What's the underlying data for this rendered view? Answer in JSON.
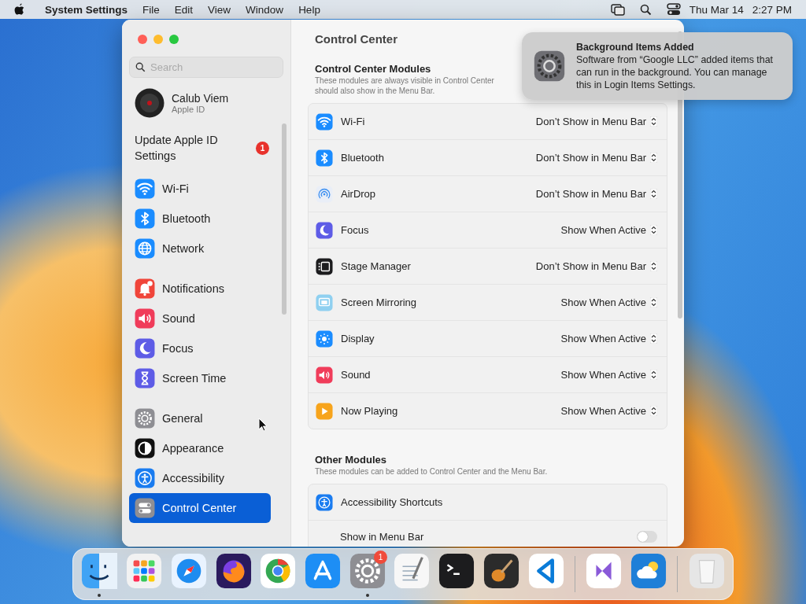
{
  "menu_bar": {
    "app_name": "System Settings",
    "menus": [
      "File",
      "Edit",
      "View",
      "Window",
      "Help"
    ],
    "date": "Thu Mar 14",
    "time": "2:27 PM"
  },
  "sidebar": {
    "search": {
      "placeholder": "Search"
    },
    "account": {
      "name": "Calub Viem",
      "subtitle": "Apple ID"
    },
    "update": {
      "label": "Update Apple ID Settings",
      "badge": "1"
    },
    "groups": [
      [
        {
          "label": "Wi-Fi",
          "selected": false
        },
        {
          "label": "Bluetooth",
          "selected": false
        },
        {
          "label": "Network",
          "selected": false
        }
      ],
      [
        {
          "label": "Notifications",
          "selected": false
        },
        {
          "label": "Sound",
          "selected": false
        },
        {
          "label": "Focus",
          "selected": false
        },
        {
          "label": "Screen Time",
          "selected": false
        }
      ],
      [
        {
          "label": "General",
          "selected": false
        },
        {
          "label": "Appearance",
          "selected": false
        },
        {
          "label": "Accessibility",
          "selected": false
        },
        {
          "label": "Control Center",
          "selected": true
        }
      ]
    ]
  },
  "content": {
    "title": "Control Center",
    "sections": [
      {
        "title": "Control Center Modules",
        "description_lines": [
          "These modules are always visible in Control Center",
          "should also show in the Menu Bar."
        ],
        "rows": [
          {
            "kind": "module",
            "label": "Wi-Fi",
            "value": "Don’t Show in Menu Bar"
          },
          {
            "kind": "module",
            "label": "Bluetooth",
            "value": "Don’t Show in Menu Bar"
          },
          {
            "kind": "module",
            "label": "AirDrop",
            "value": "Don’t Show in Menu Bar"
          },
          {
            "kind": "module",
            "label": "Focus",
            "value": "Show When Active"
          },
          {
            "kind": "module",
            "label": "Stage Manager",
            "value": "Don’t Show in Menu Bar"
          },
          {
            "kind": "module",
            "label": "Screen Mirroring",
            "value": "Show When Active"
          },
          {
            "kind": "module",
            "label": "Display",
            "value": "Show When Active"
          },
          {
            "kind": "module",
            "label": "Sound",
            "value": "Show When Active"
          },
          {
            "kind": "module",
            "label": "Now Playing",
            "value": "Show When Active"
          }
        ]
      },
      {
        "title": "Other Modules",
        "description_lines": [
          "These modules can be added to Control Center and the Menu Bar."
        ],
        "rows": [
          {
            "kind": "heading",
            "label": "Accessibility Shortcuts"
          },
          {
            "kind": "toggle",
            "label": "Show in Menu Bar",
            "on": false
          }
        ]
      }
    ]
  },
  "notification": {
    "title": "Background Items Added",
    "body": "Software from “Google LLC” added items that can run in the background. You can manage this in Login Items Settings."
  },
  "dock": {
    "items": [
      {
        "running": true
      },
      {
        "running": false
      },
      {
        "running": false
      },
      {
        "running": false
      },
      {
        "running": false
      },
      {
        "running": false
      },
      {
        "running": true,
        "badge": "1"
      },
      {
        "running": false
      },
      {
        "running": false
      },
      {
        "running": false
      },
      {
        "running": false
      },
      {
        "running": false
      },
      {
        "running": false
      },
      {
        "running": false
      }
    ]
  }
}
